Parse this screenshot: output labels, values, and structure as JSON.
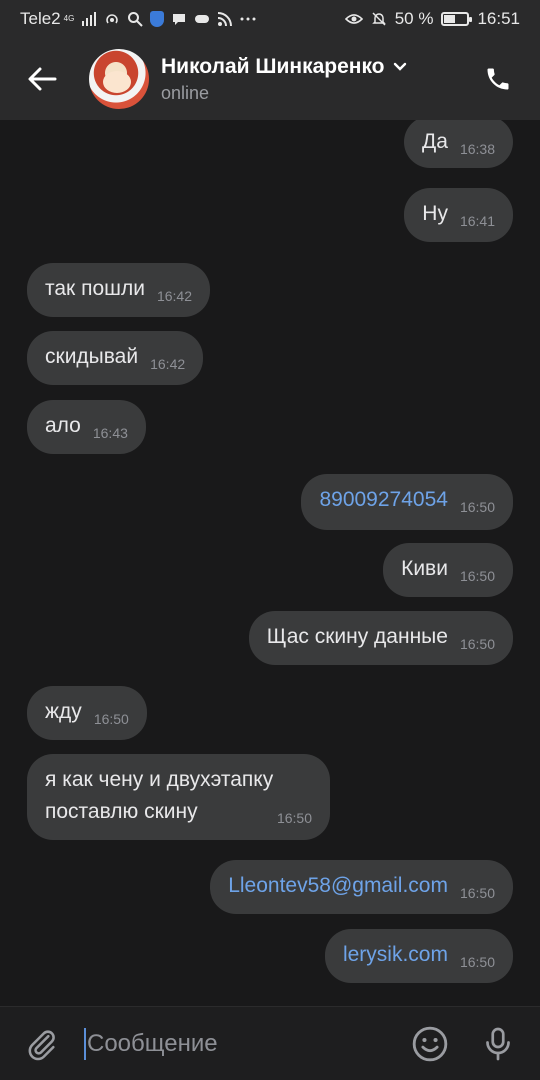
{
  "status_bar": {
    "carrier": "Tele2",
    "network": "4G",
    "battery_percent": "50 %",
    "battery_level": 0.5,
    "time": "16:51"
  },
  "header": {
    "contact_name": "Николай Шинкаренко",
    "status": "online",
    "icons": [
      "back-arrow-icon",
      "chevron-down-icon",
      "phone-icon"
    ]
  },
  "messages": [
    {
      "side": "out",
      "text": "Да",
      "time": "16:38"
    },
    {
      "side": "out",
      "text": "Ну",
      "time": "16:41"
    },
    {
      "side": "in",
      "text": "так пошли",
      "time": "16:42"
    },
    {
      "side": "in",
      "text": "скидывай",
      "time": "16:42"
    },
    {
      "side": "in",
      "text": "ало",
      "time": "16:43"
    },
    {
      "side": "out",
      "text": "89009274054",
      "time": "16:50",
      "link": true
    },
    {
      "side": "out",
      "text": "Киви",
      "time": "16:50"
    },
    {
      "side": "out",
      "text": "Щас скину данные",
      "time": "16:50"
    },
    {
      "side": "in",
      "text": "жду",
      "time": "16:50"
    },
    {
      "side": "in",
      "text": [
        "я как чену и двухэтапку",
        "поставлю скину"
      ],
      "time": "16:50"
    },
    {
      "side": "out",
      "text": "Lleontev58@gmail.com",
      "time": "16:50",
      "link": true
    },
    {
      "side": "out",
      "text": "lerysik.com",
      "time": "16:50",
      "link": true
    }
  ],
  "composer": {
    "placeholder": "Сообщение",
    "value": "",
    "icons": [
      "paperclip-icon",
      "smiley-icon",
      "microphone-icon"
    ]
  },
  "colors": {
    "background": "#19191a",
    "bar": "#2a2a2b",
    "bubble": "#3a3b3c",
    "link": "#6ea3e8",
    "caret": "#5b8fd8"
  }
}
